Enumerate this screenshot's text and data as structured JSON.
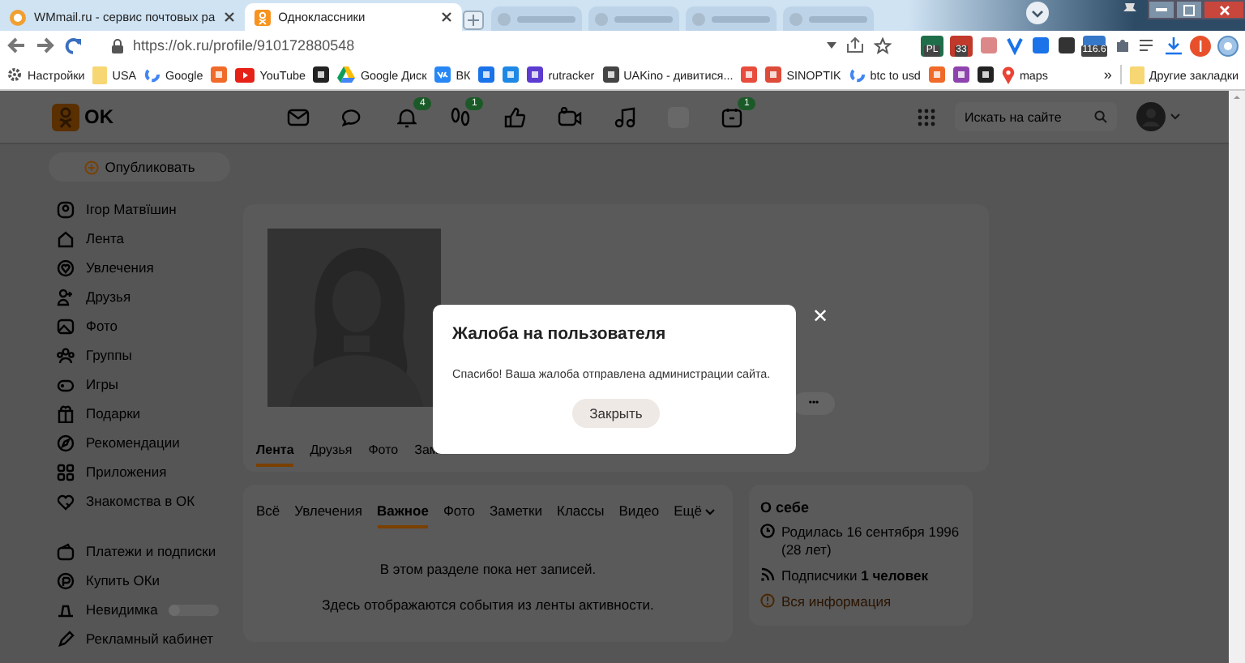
{
  "browser": {
    "tabs": [
      {
        "title": "WMmail.ru - сервис почтовых ра",
        "selected": false
      },
      {
        "title": "Одноклассники",
        "selected": true
      }
    ],
    "url": "https://ok.ru/profile/910172880548",
    "extension_badges": [
      "PL",
      "33",
      "116.6"
    ],
    "bookmarks": [
      {
        "kind": "settings",
        "label": "Настройки"
      },
      {
        "kind": "folder",
        "label": "USA"
      },
      {
        "kind": "google",
        "label": "Google"
      },
      {
        "kind": "site"
      },
      {
        "kind": "youtube",
        "label": "YouTube"
      },
      {
        "kind": "site"
      },
      {
        "kind": "drive",
        "label": "Google Диск"
      },
      {
        "kind": "vk",
        "label": "ВК"
      },
      {
        "kind": "site"
      },
      {
        "kind": "site"
      },
      {
        "kind": "site",
        "label": "rutracker"
      },
      {
        "kind": "site",
        "label": "UAKino - дивитися..."
      },
      {
        "kind": "site"
      },
      {
        "kind": "site",
        "label": "SINOPTIK"
      },
      {
        "kind": "google",
        "label": "btc to usd"
      },
      {
        "kind": "site"
      },
      {
        "kind": "site"
      },
      {
        "kind": "site"
      },
      {
        "kind": "maps",
        "label": "maps"
      }
    ],
    "more_bookmarks": "»",
    "other_bookmarks": "Другие закладки"
  },
  "header": {
    "logo": "OK",
    "notifications_badge": "4",
    "guests_badge": "1",
    "events_badge": "1",
    "search": {
      "placeholder": "Искать на сайте"
    }
  },
  "sidebar": {
    "publish_button": "Опубликовать",
    "items": [
      {
        "label": "Ігор Матвїшин"
      },
      {
        "label": "Лента"
      },
      {
        "label": "Увлечения"
      },
      {
        "label": "Друзья"
      },
      {
        "label": "Фото"
      },
      {
        "label": "Группы"
      },
      {
        "label": "Игры"
      },
      {
        "label": "Подарки"
      },
      {
        "label": "Рекомендации"
      },
      {
        "label": "Приложения"
      },
      {
        "label": "Знакомства в ОК"
      }
    ],
    "extra_items": [
      {
        "label": "Платежи и подписки",
        "kind": "link"
      },
      {
        "label": "Купить ОКи",
        "kind": "link"
      },
      {
        "label": "Невидимка",
        "kind": "toggle",
        "on": false
      },
      {
        "label": "Рекламный кабинет",
        "kind": "link"
      }
    ]
  },
  "profile": {
    "more_button": "•••",
    "tabs": [
      {
        "label": "Лента",
        "selected": true
      },
      {
        "label": "Друзья",
        "selected": false
      },
      {
        "label": "Фото",
        "selected": false
      },
      {
        "label": "Зам",
        "selected": false
      }
    ],
    "filters": [
      {
        "label": "Всё",
        "kind": "tab",
        "selected": false
      },
      {
        "label": "Увлечения",
        "kind": "tab",
        "selected": false
      },
      {
        "label": "Важное",
        "kind": "tab",
        "selected": true
      },
      {
        "label": "Фото",
        "kind": "tab",
        "selected": false
      },
      {
        "label": "Заметки",
        "kind": "tab",
        "selected": false
      },
      {
        "label": "Классы",
        "kind": "tab",
        "selected": false
      },
      {
        "label": "Видео",
        "kind": "tab",
        "selected": false
      },
      {
        "label": "Ещё",
        "kind": "dropdown",
        "selected": false
      }
    ],
    "empty_title": "В этом разделе пока нет записей.",
    "empty_text": "Здесь отображаются события из ленты активности."
  },
  "about": {
    "title": "О себе",
    "birth": "Родилась 16 сентября 1996 (28 лет)",
    "followers": "Подписчики **1 человек**",
    "link": "Вся информация"
  },
  "dialog": {
    "title": "Жалоба на пользователя",
    "message": "Спасибо! Ваша жалоба отправлена администрации сайта.",
    "button": "Закрыть",
    "close": "✕"
  }
}
